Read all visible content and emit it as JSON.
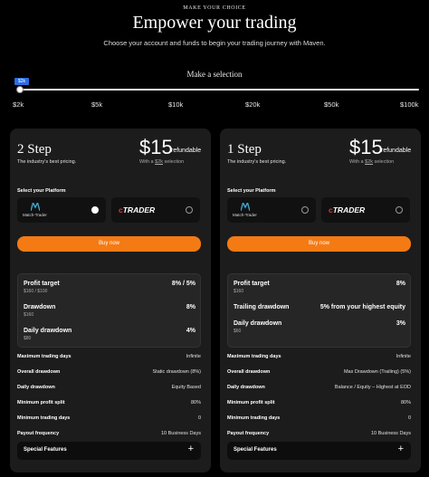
{
  "header": {
    "eyebrow": "MAKE YOUR CHOICE",
    "title": "Empower your trading",
    "subtitle": "Choose your account and funds to begin your trading journey with Maven.",
    "make_selection": "Make a selection"
  },
  "slider": {
    "badge": "$2k",
    "ticks": [
      "$2k",
      "$5k",
      "$10k",
      "$20k",
      "$50k",
      "$100k"
    ],
    "selected_index": 0
  },
  "plans": [
    {
      "step": "2 Step",
      "tagline": "The industry's best pricing.",
      "price": "$15",
      "refundable": "refundable",
      "with_prefix": "With a ",
      "with_amount": "$2k",
      "with_suffix": " selection",
      "platform_label": "Select your Platform",
      "platforms": [
        {
          "name": "Match-Trader",
          "selected": true
        },
        {
          "name": "TRADER",
          "selected": false
        }
      ],
      "buy_label": "Buy now",
      "metrics": [
        {
          "name": "Profit target",
          "value": "8% / 5%",
          "sub": "$160 / $100"
        },
        {
          "name": "Drawdown",
          "value": "8%",
          "sub": "$160"
        },
        {
          "name": "Daily drawdown",
          "value": "4%",
          "sub": "$80"
        }
      ],
      "rows": [
        {
          "key": "Maximum trading days",
          "value": "Infinite"
        },
        {
          "key": "Overall drawdown",
          "value": "Static drawdown (8%)"
        },
        {
          "key": "Daily drawdown",
          "value": "Equity Based"
        },
        {
          "key": "Minimum profit split",
          "value": "80%"
        },
        {
          "key": "Minimum trading days",
          "value": "0"
        },
        {
          "key": "Payout frequency",
          "value": "10 Business Days"
        }
      ],
      "special": "Special Features",
      "plus": "+"
    },
    {
      "step": "1 Step",
      "tagline": "The industry's best pricing.",
      "price": "$15",
      "refundable": "refundable",
      "with_prefix": "With a ",
      "with_amount": "$2k",
      "with_suffix": " selection",
      "platform_label": "Select your Platform",
      "platforms": [
        {
          "name": "Match-Trader",
          "selected": false
        },
        {
          "name": "TRADER",
          "selected": false
        }
      ],
      "buy_label": "Buy now",
      "metrics": [
        {
          "name": "Profit target",
          "value": "8%",
          "sub": "$160"
        },
        {
          "name": "Trailing drawdown",
          "value": "5% from your highest equity",
          "sub": ""
        },
        {
          "name": "Daily drawdown",
          "value": "3%",
          "sub": "$60"
        }
      ],
      "rows": [
        {
          "key": "Maximum trading days",
          "value": "Infinite"
        },
        {
          "key": "Overall drawdown",
          "value": "Max Drawdown (Trailing) (5%)"
        },
        {
          "key": "Daily drawdown",
          "value": "Balance / Equity – Highest at EOD"
        },
        {
          "key": "Minimum profit split",
          "value": "80%"
        },
        {
          "key": "Minimum trading days",
          "value": "0"
        },
        {
          "key": "Payout frequency",
          "value": "10 Business Days"
        }
      ],
      "special": "Special Features",
      "plus": "+"
    }
  ],
  "colors": {
    "accent": "#f47a14",
    "slider_badge": "#2a6de1",
    "card_bg": "#1c1c1c",
    "ctrader_c": "#e53935",
    "match_trader_mark": "#3fa3c9"
  }
}
